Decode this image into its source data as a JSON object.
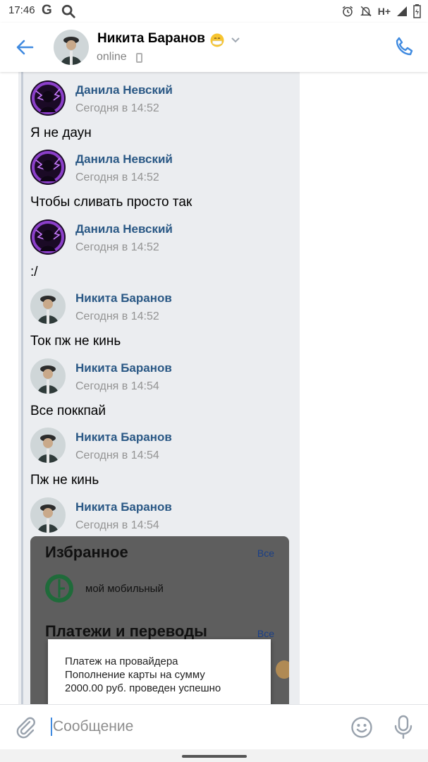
{
  "status_bar": {
    "time": "17:46",
    "g_label": "G",
    "network": "H+",
    "icons": [
      "google-icon",
      "search-icon",
      "alarm-icon",
      "mute-icon",
      "signal-icon",
      "battery-icon"
    ]
  },
  "header": {
    "name": "Никита Баранов",
    "status": "online",
    "emoji_icon": "mask-face-emoji",
    "icons": [
      "back-arrow-icon",
      "chevron-down-icon",
      "mobile-indicator-icon",
      "phone-icon"
    ],
    "accent_color": "#3f8ae0"
  },
  "messages": [
    {
      "author": "Данила Невский",
      "time": "Сегодня в 14:52",
      "text": "Я не даун",
      "avatar": "purple-avatar"
    },
    {
      "author": "Данила Невский",
      "time": "Сегодня в 14:52",
      "text": "Чтобы сливать просто так",
      "avatar": "purple-avatar"
    },
    {
      "author": "Данила Невский",
      "time": "Сегодня в 14:52",
      "text": ":/",
      "avatar": "purple-avatar"
    },
    {
      "author": "Никита Баранов",
      "time": "Сегодня в 14:52",
      "text": "Ток пж не кинь",
      "avatar": "man-avatar"
    },
    {
      "author": "Никита Баранов",
      "time": "Сегодня в 14:54",
      "text": "Все поккпай",
      "avatar": "man-avatar"
    },
    {
      "author": "Никита Баранов",
      "time": "Сегодня в 14:54",
      "text": "Пж не кинь",
      "avatar": "man-avatar"
    },
    {
      "author": "Никита Баранов",
      "time": "Сегодня в 14:54",
      "text": "",
      "avatar": "man-avatar"
    }
  ],
  "attachment": {
    "favorites_title": "Избранное",
    "favorites_all": "Все",
    "favorite_item": "мой мобильный",
    "payments_title": "Платежи и переводы",
    "payments_all": "Все",
    "toast_line1": "Платеж на провайдера",
    "toast_line2": "Пополнение карты на сумму",
    "toast_line3": "2000.00 руб. проведен успешно"
  },
  "input": {
    "placeholder": "Сообщение",
    "value": "",
    "icons": [
      "paperclip-icon",
      "smile-icon",
      "microphone-icon"
    ]
  },
  "colors": {
    "author_link": "#2a5885",
    "forward_bg": "#ebedf0",
    "timestamp": "#939393"
  }
}
